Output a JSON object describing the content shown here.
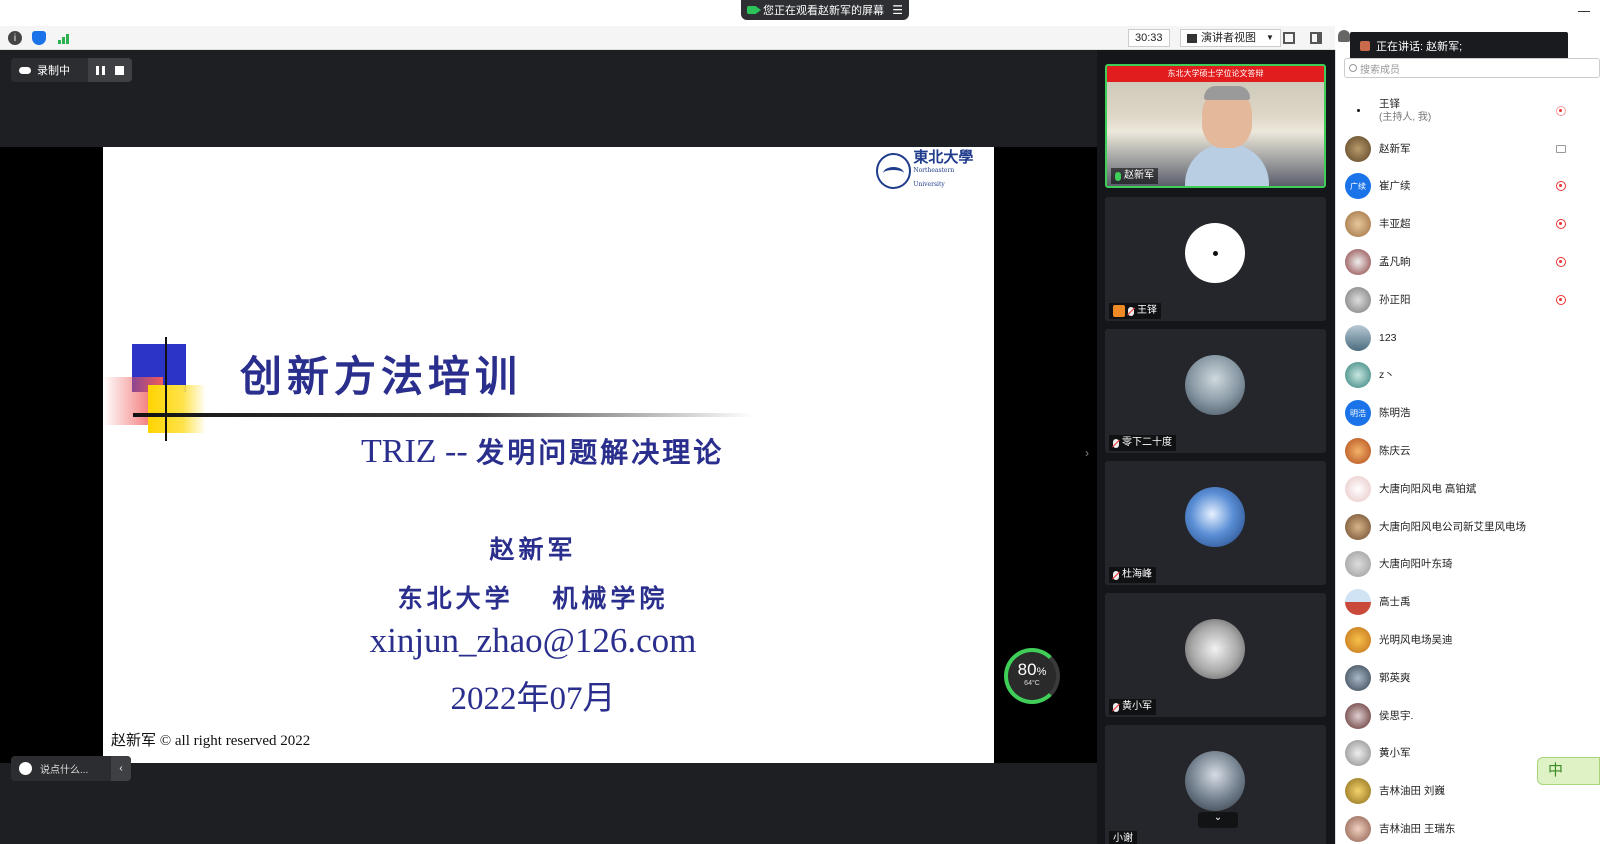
{
  "banner": {
    "text": "您正在观看赵新军的屏幕"
  },
  "toolbar": {
    "timer": "30:33",
    "view_label": "演讲者视图",
    "icons": [
      "info-icon",
      "shield-icon",
      "signal-icon",
      "fullscreen-icon",
      "sidebar-icon"
    ]
  },
  "recording": {
    "label": "录制中"
  },
  "slide": {
    "logo_cn": "東北大學",
    "logo_en": "Northeastern University",
    "title": "创新方法培训",
    "subtitle_en": "TRIZ -- ",
    "subtitle_cn": "发明问题解决理论",
    "author": "赵新军",
    "org": "东北大学 机械学院",
    "email": "xinjun_zhao@126.com",
    "date": "2022年07月",
    "footer": "赵新军 © all right reserved 2022"
  },
  "gauge": {
    "percent": "80",
    "unit": "%",
    "temp": "64°C"
  },
  "chat": {
    "placeholder": "说点什么..."
  },
  "gallery": {
    "tiles": [
      {
        "name": "赵新军",
        "banner": "东北大学硕士学位论文答辩"
      },
      {
        "name": "王铎"
      },
      {
        "name": "零下二十度"
      },
      {
        "name": "杜海峰"
      },
      {
        "name": "黄小军"
      },
      {
        "name": "小谢"
      }
    ]
  },
  "panel": {
    "speaking": "正在讲话: 赵新军;",
    "search_placeholder": "搜索成员",
    "participants": [
      {
        "name": "王铎",
        "sub": "(主持人, 我)"
      },
      {
        "name": "赵新军"
      },
      {
        "name": "崔广续",
        "avatar_text": "广续"
      },
      {
        "name": "丰亚超"
      },
      {
        "name": "孟凡晌"
      },
      {
        "name": "孙正阳"
      },
      {
        "name": "123"
      },
      {
        "name": "z丶"
      },
      {
        "name": "陈明浩",
        "avatar_text": "明浩"
      },
      {
        "name": "陈庆云"
      },
      {
        "name": "大唐向阳风电 高铂斌"
      },
      {
        "name": "大唐向阳风电公司新艾里风电场"
      },
      {
        "name": "大唐向阳叶东琦"
      },
      {
        "name": "高士禹"
      },
      {
        "name": "光明风电场吴迪"
      },
      {
        "name": "郭英爽"
      },
      {
        "name": "侯思宇."
      },
      {
        "name": "黄小军"
      },
      {
        "name": "吉林油田 刘巍"
      },
      {
        "name": "吉林油田 王瑞东"
      }
    ]
  },
  "ime": {
    "label": "中"
  },
  "colors": {
    "accent_green": "#3fce57",
    "slide_text": "#2a2e8c",
    "record_red": "#e33333",
    "avatar_blue": "#1a73e8"
  }
}
